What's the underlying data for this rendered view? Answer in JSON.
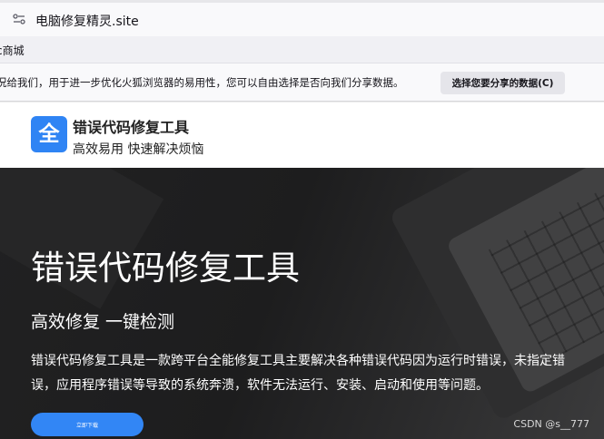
{
  "browser": {
    "url": "电脑修复精灵.site",
    "bookmark": "c商城"
  },
  "notice": {
    "text": "况给我们，用于进一步优化火狐浏览器的易用性，您可以自由选择是否向我们分享数据。",
    "button": "选择您要分享的数据(C)"
  },
  "header": {
    "logo_char": "全",
    "name": "错误代码修复工具",
    "tagline": "高效易用 快速解决烦恼"
  },
  "hero": {
    "title": "错误代码修复工具",
    "subtitle": "高效修复 一键检测",
    "description": "错误代码修复工具是一款跨平台全能修复工具主要解决各种错误代码因为运行时错误，未指定错误，应用程序错误等导致的系统奔溃，软件无法运行、安装、启动和使用等问题。",
    "button": "立即下载",
    "watermark": "CSDN @s__777"
  },
  "icons": {
    "url_icon": "connection-info-icon",
    "logo": "app-logo"
  },
  "colors": {
    "accent": "#2f84f4",
    "hero_bg": "#1f1f20"
  }
}
